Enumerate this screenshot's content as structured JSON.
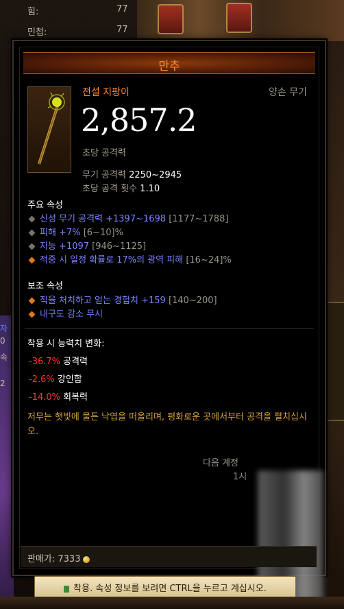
{
  "background": {
    "stats": [
      {
        "label": "힘:",
        "value": "77"
      },
      {
        "label": "민첩:",
        "value": "77"
      }
    ],
    "left_fragments": [
      "자",
      "0",
      "속",
      "2"
    ]
  },
  "tooltip": {
    "header_title": "만추",
    "item_type": "전설 지팡이",
    "slot": "양손 무기",
    "dps_value": "2,857.2",
    "dps_label": "초당 공격력",
    "weapon_damage_label": "무기 공격력",
    "weapon_damage_value": "2250~2945",
    "attack_speed_label": "초당 공격 횟수",
    "attack_speed_value": "1.10",
    "primary_title": "주요 속성",
    "primary_props": [
      {
        "text": "신성 무기 공격력 +1397~1698",
        "range": "[1177~1788]"
      },
      {
        "text": "피해 +7%",
        "range": "[6~10]%"
      },
      {
        "text": "지능 +1097",
        "range": "[946~1125]"
      },
      {
        "text": "적중 시 일정 확률로 17%의 광역 피해",
        "range": "[16~24]%"
      }
    ],
    "secondary_title": "보조 속성",
    "secondary_props": [
      {
        "text": "적을 처치하고 얻는 경험치 +159",
        "range": "[140~200]"
      },
      {
        "text": "내구도 감소 무시",
        "range": ""
      }
    ],
    "equip_change_title": "착용 시 능력치 변화:",
    "equip_changes": [
      {
        "value": "-36.7%",
        "name": "공격력"
      },
      {
        "value": "-2.6%",
        "name": "강인함"
      },
      {
        "value": "-14.0%",
        "name": "회복력"
      }
    ],
    "flavor_text": "저무는 햇빛에 물든 낙엽을 떠올리며, 평화로운 곳에서부터 공격을 펼치십시오.",
    "craft_fragment_1": "다음 계정",
    "craft_fragment_2": "1시",
    "price_label": "판매가: 7333",
    "bottom_hint": "착용. 속성 정보를 보려면 CTRL을 누르고 계십시오."
  },
  "colors": {
    "legendary": "#ff8a2a",
    "magic_prop": "#7a82ff",
    "negative": "#ff3a2a",
    "flavor": "#d4a040"
  }
}
